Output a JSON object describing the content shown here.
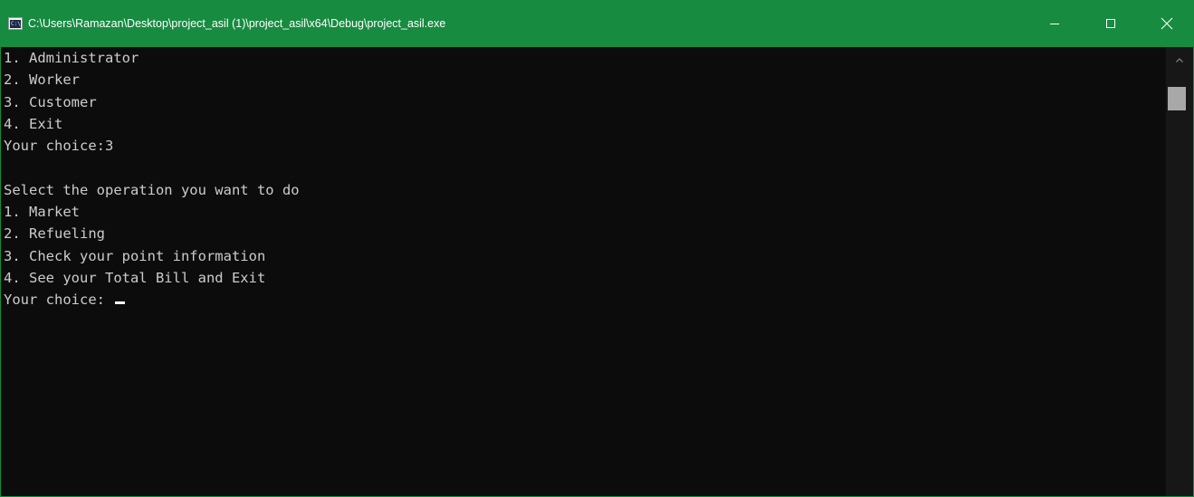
{
  "window": {
    "title": "C:\\Users\\Ramazan\\Desktop\\project_asil (1)\\project_asil\\x64\\Debug\\project_asil.exe",
    "icon": "console-app-icon",
    "icon_text": "C:\\",
    "titlebar_color": "#178b40"
  },
  "caption_buttons": {
    "minimize": "minimize-icon",
    "maximize": "maximize-icon",
    "close": "close-icon"
  },
  "console": {
    "lines": [
      "1. Administrator",
      "2. Worker",
      "3. Customer",
      "4. Exit",
      "Your choice:3",
      "",
      "Select the operation you want to do",
      "1. Market",
      "2. Refueling",
      "3. Check your point information",
      "4. See your Total Bill and Exit",
      "Your choice: "
    ],
    "text_color": "#cccccc",
    "background": "#0c0c0c"
  },
  "scrollbar": {
    "up_arrow": "chevron-up-icon"
  }
}
